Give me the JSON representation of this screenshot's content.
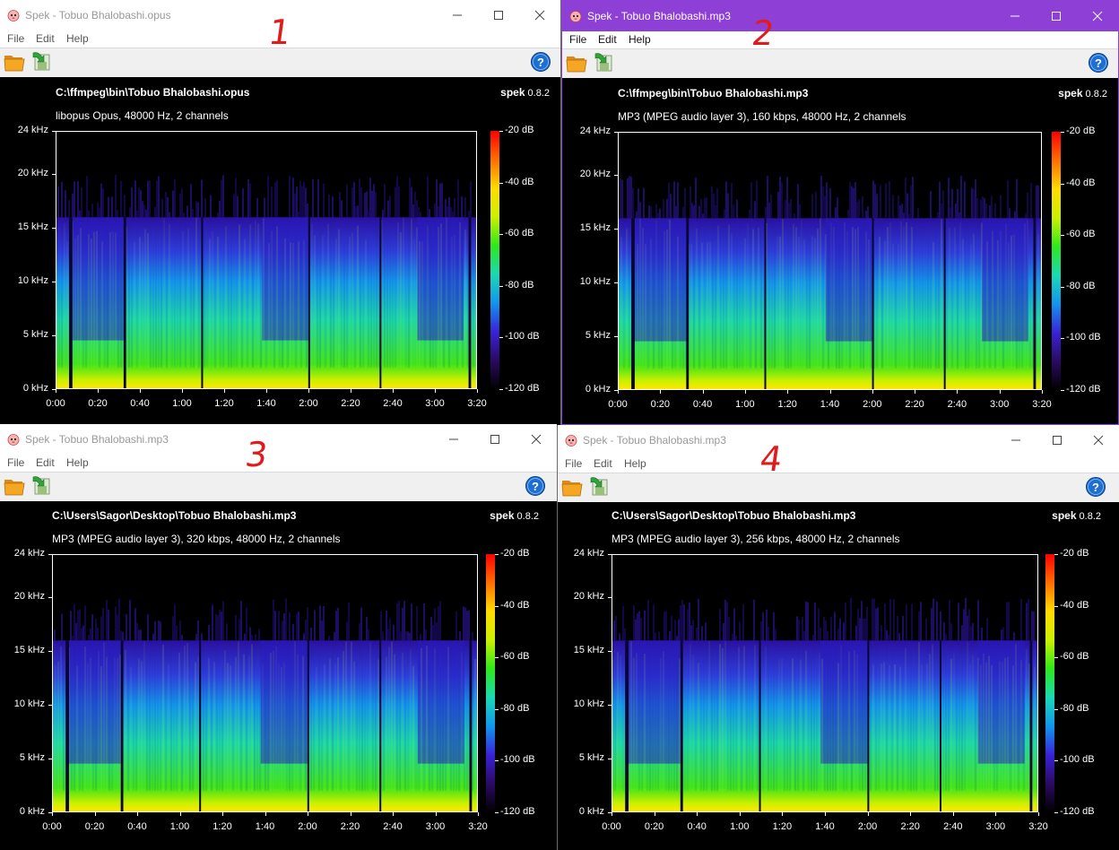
{
  "menu": {
    "file": "File",
    "edit": "Edit",
    "help": "Help"
  },
  "scales": {
    "freq_ticks": [
      "24 kHz",
      "20 kHz",
      "15 kHz",
      "10 kHz",
      "5 kHz",
      "0 kHz"
    ],
    "time_ticks": [
      "0:00",
      "0:20",
      "0:40",
      "1:00",
      "1:20",
      "1:40",
      "2:00",
      "2:20",
      "2:40",
      "3:00",
      "3:20"
    ],
    "db_ticks": [
      "-20 dB",
      "-40 dB",
      "-60 dB",
      "-80 dB",
      "-100 dB",
      "-120 dB"
    ]
  },
  "brand": {
    "name": "spek",
    "version": "0.8.2"
  },
  "colors": {
    "active_title": "#8e3fd6",
    "annotation": "#e11b1b",
    "spectrum_gradient": [
      "#000000",
      "#2b0a62",
      "#3a22d8",
      "#1096ee",
      "#1ad9b4",
      "#2ee81a",
      "#ccf000",
      "#ffdc00",
      "#ff6e00",
      "#ff0000"
    ]
  },
  "windows": [
    {
      "number_label": "1",
      "title": "Spek - Tobuo Bhalobashi.opus",
      "active": false,
      "file_path": "C:\\ffmpeg\\bin\\Tobuo Bhalobashi.opus",
      "audio_info": "libopus Opus, 48000 Hz, 2 channels",
      "cutoff_khz": 20,
      "band_khz": 16
    },
    {
      "number_label": "2",
      "title": "Spek - Tobuo Bhalobashi.mp3",
      "active": true,
      "file_path": "C:\\ffmpeg\\bin\\Tobuo Bhalobashi.mp3",
      "audio_info": "MP3 (MPEG audio layer 3), 160 kbps, 48000 Hz, 2 channels",
      "cutoff_khz": 20,
      "band_khz": 16
    },
    {
      "number_label": "3",
      "title": "Spek - Tobuo Bhalobashi.mp3",
      "active": false,
      "file_path": "C:\\Users\\Sagor\\Desktop\\Tobuo Bhalobashi.mp3",
      "audio_info": "MP3 (MPEG audio layer 3), 320 kbps, 48000 Hz, 2 channels",
      "cutoff_khz": 20,
      "band_khz": 16
    },
    {
      "number_label": "4",
      "title": "Spek - Tobuo Bhalobashi.mp3",
      "active": false,
      "file_path": "C:\\Users\\Sagor\\Desktop\\Tobuo Bhalobashi.mp3",
      "audio_info": "MP3 (MPEG audio layer 3), 256 kbps, 48000 Hz, 2 channels",
      "cutoff_khz": 20,
      "band_khz": 16
    }
  ]
}
